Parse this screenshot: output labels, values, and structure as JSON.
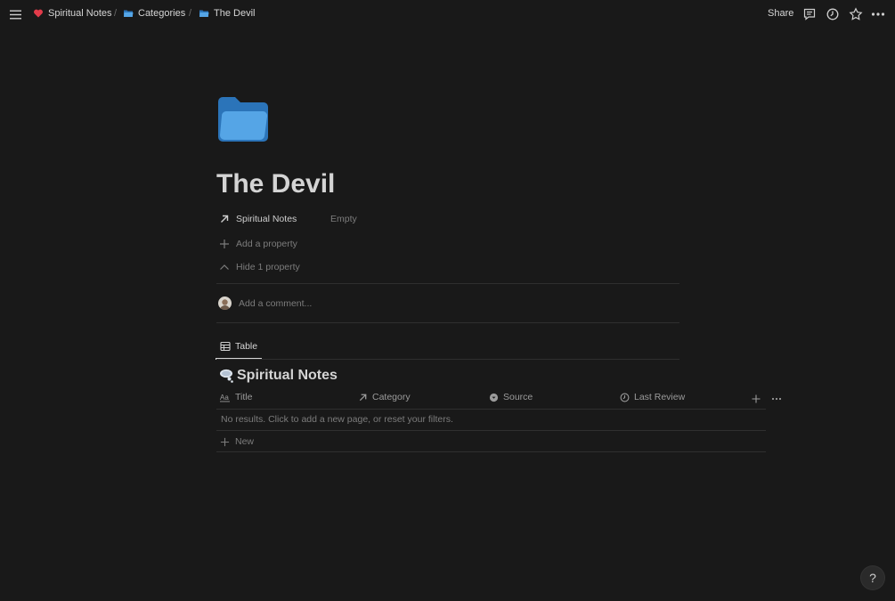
{
  "breadcrumb": {
    "items": [
      {
        "label": "Spiritual Notes",
        "icon": "heart-icon"
      },
      {
        "label": "Categories",
        "icon": "folder-icon"
      },
      {
        "label": "The Devil",
        "icon": "folder-icon"
      }
    ],
    "separator": "/"
  },
  "topbar": {
    "share_label": "Share",
    "icons": [
      "comment-icon",
      "clock-icon",
      "star-icon",
      "more-icon"
    ]
  },
  "page": {
    "icon": "folder-icon",
    "title": "The Devil"
  },
  "properties": {
    "relation_label": "Spiritual Notes",
    "relation_value": "Empty",
    "add_property_label": "Add a property",
    "hide_property_label": "Hide 1 property"
  },
  "comment": {
    "placeholder": "Add a comment..."
  },
  "view_tab": {
    "label": "Table"
  },
  "database": {
    "title": "Spiritual Notes",
    "columns": [
      {
        "label": "Title",
        "icon": "text-icon"
      },
      {
        "label": "Category",
        "icon": "arrow-up-right-icon"
      },
      {
        "label": "Source",
        "icon": "select-icon"
      },
      {
        "label": "Last Review",
        "icon": "clock-icon"
      }
    ],
    "empty_message": "No results. Click to add a new page, or reset your filters.",
    "new_label": "New"
  },
  "help_label": "?",
  "colors": {
    "background": "#191919",
    "folder_front": "#55a5e6",
    "folder_back": "#2b74b9",
    "heart": "#e23b4a"
  }
}
